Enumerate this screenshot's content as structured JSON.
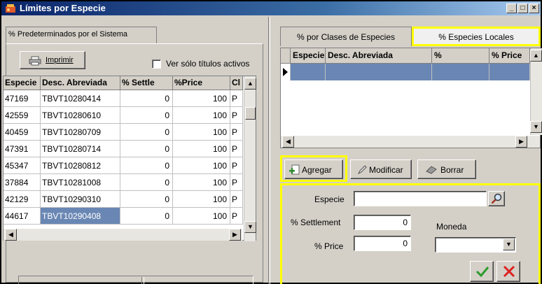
{
  "window": {
    "title": "Límites por Especie"
  },
  "left": {
    "tab_label": "% Predeterminados por el Sistema",
    "print_label": "Imprimir",
    "checkbox_label": "Ver sólo títulos activos",
    "columns": [
      "Especie",
      "Desc. Abreviada",
      "% Settle",
      "%Price",
      "Cl"
    ],
    "rows": [
      {
        "especie": "47169",
        "desc": "TBVT10280414",
        "settle": "0",
        "price": "100",
        "cl": "P"
      },
      {
        "especie": "42559",
        "desc": "TBVT10280610",
        "settle": "0",
        "price": "100",
        "cl": "P"
      },
      {
        "especie": "40459",
        "desc": "TBVT10280709",
        "settle": "0",
        "price": "100",
        "cl": "P"
      },
      {
        "especie": "47391",
        "desc": "TBVT10280714",
        "settle": "0",
        "price": "100",
        "cl": "P"
      },
      {
        "especie": "45347",
        "desc": "TBVT10280812",
        "settle": "0",
        "price": "100",
        "cl": "P"
      },
      {
        "especie": "37884",
        "desc": "TBVT10281008",
        "settle": "0",
        "price": "100",
        "cl": "P"
      },
      {
        "especie": "42129",
        "desc": "TBVT10290310",
        "settle": "0",
        "price": "100",
        "cl": "P"
      },
      {
        "especie": "44617",
        "desc": "TBVT10290408",
        "settle": "0",
        "price": "100",
        "cl": "P"
      }
    ]
  },
  "right": {
    "tabs": [
      "% por Clases de Especies",
      "% Especies Locales"
    ],
    "columns": [
      "Especie",
      "Desc. Abreviada",
      "%",
      "% Price"
    ],
    "buttons": {
      "add": "Agregar",
      "modify": "Modificar",
      "delete": "Borrar"
    },
    "form": {
      "especie_label": "Especie",
      "settlement_label": "% Settlement",
      "settlement_value": "0",
      "price_label": "% Price",
      "price_value": "0",
      "moneda_label": "Moneda"
    }
  },
  "colors": {
    "highlight": "#ffff00",
    "selection": "#6a87b4",
    "title_bar": "#0a246a"
  }
}
